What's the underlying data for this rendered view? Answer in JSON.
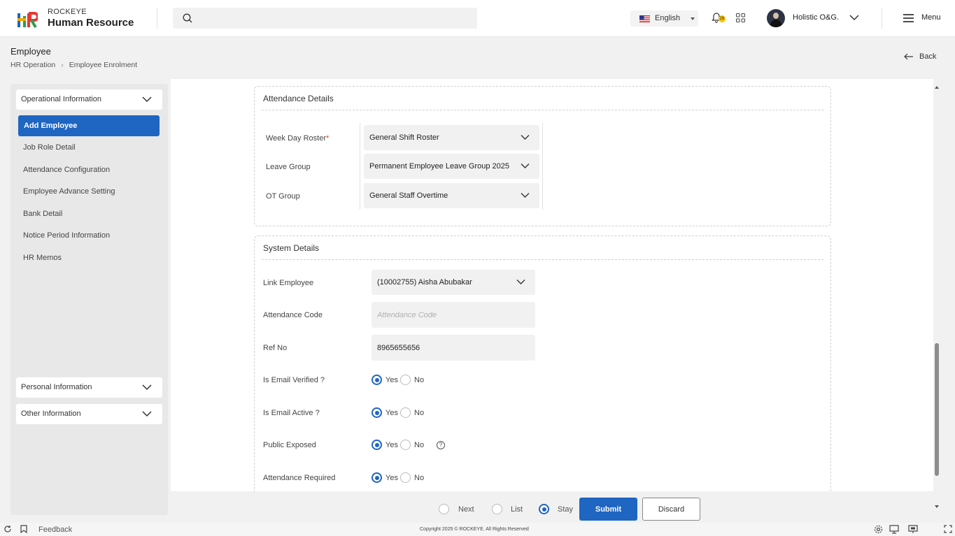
{
  "header": {
    "brand_top": "ROCKEYE",
    "brand_main": "Human Resource",
    "language": "English",
    "notification_count": "26",
    "user_name": "Holistic O&G.",
    "menu_label": "Menu"
  },
  "page": {
    "title": "Employee",
    "breadcrumb": [
      "HR Operation",
      "Employee Enrolment"
    ],
    "back_label": "Back"
  },
  "sidebar": {
    "operational_header": "Operational Information",
    "active_item": "Add Employee",
    "items": [
      "Job Role Detail",
      "Attendance Configuration",
      "Employee Advance Setting",
      "Bank Detail",
      "Notice Period Information",
      "HR Memos"
    ],
    "personal_header": "Personal Information",
    "other_header": "Other Information"
  },
  "attendance": {
    "title": "Attendance Details",
    "week_day_roster_label": "Week Day Roster",
    "week_day_roster_required": "*",
    "week_day_roster_value": "General Shift Roster",
    "leave_group_label": "Leave Group",
    "leave_group_value": "Permanent Employee Leave Group 2025",
    "ot_group_label": "OT Group",
    "ot_group_value": "General Staff Overtime"
  },
  "system": {
    "title": "System Details",
    "link_employee_label": "Link Employee",
    "link_employee_value": "(10002755) Aisha Abubakar",
    "attendance_code_label": "Attendance Code",
    "attendance_code_placeholder": "Attendance Code",
    "ref_no_label": "Ref No",
    "ref_no_value": "8965655656",
    "yes_label": "Yes",
    "no_label": "No",
    "email_verified_label": "Is Email Verified ?",
    "email_active_label": "Is Email Active ?",
    "public_exposed_label": "Public Exposed",
    "attendance_required_label": "Attendance Required"
  },
  "actions": {
    "next_label": "Next",
    "list_label": "List",
    "stay_label": "Stay",
    "submit_label": "Submit",
    "discard_label": "Discard"
  },
  "footer": {
    "feedback_label": "Feedback",
    "copyright": "Copyright 2025 © ROCKEYE. All Rights Reserved"
  },
  "colors": {
    "primary": "#1f65c2",
    "required": "#e53935"
  }
}
